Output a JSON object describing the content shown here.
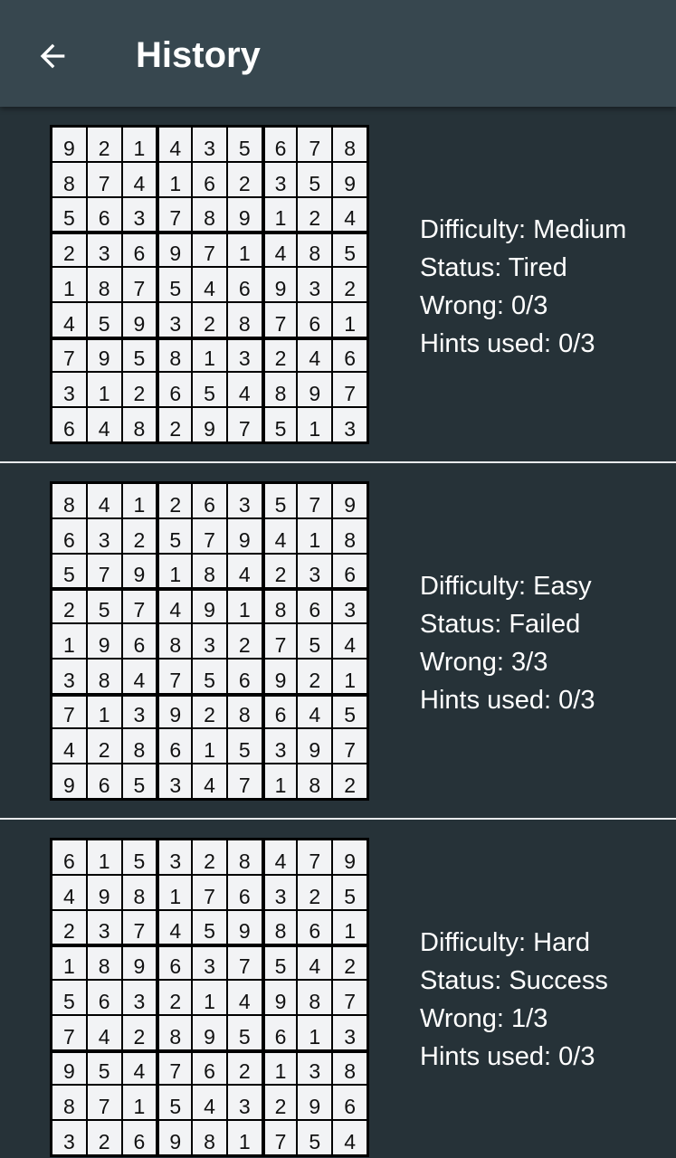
{
  "appbar": {
    "title": "History",
    "back_icon": "arrow-back-icon"
  },
  "colors": {
    "background": "#263238",
    "appbar": "#37474f",
    "cell": "#f2f3f5",
    "text": "#ffffff"
  },
  "history": [
    {
      "difficulty": "Difficulty: Medium",
      "status": "Status: Tired",
      "wrong": "Wrong: 0/3",
      "hints": "Hints used: 0/3",
      "board": [
        [
          9,
          2,
          1,
          4,
          3,
          5,
          6,
          7,
          8
        ],
        [
          8,
          7,
          4,
          1,
          6,
          2,
          3,
          5,
          9
        ],
        [
          5,
          6,
          3,
          7,
          8,
          9,
          1,
          2,
          4
        ],
        [
          2,
          3,
          6,
          9,
          7,
          1,
          4,
          8,
          5
        ],
        [
          1,
          8,
          7,
          5,
          4,
          6,
          9,
          3,
          2
        ],
        [
          4,
          5,
          9,
          3,
          2,
          8,
          7,
          6,
          1
        ],
        [
          7,
          9,
          5,
          8,
          1,
          3,
          2,
          4,
          6
        ],
        [
          3,
          1,
          2,
          6,
          5,
          4,
          8,
          9,
          7
        ],
        [
          6,
          4,
          8,
          2,
          9,
          7,
          5,
          1,
          3
        ]
      ]
    },
    {
      "difficulty": "Difficulty: Easy",
      "status": "Status: Failed",
      "wrong": "Wrong: 3/3",
      "hints": "Hints used: 0/3",
      "board": [
        [
          8,
          4,
          1,
          2,
          6,
          3,
          5,
          7,
          9
        ],
        [
          6,
          3,
          2,
          5,
          7,
          9,
          4,
          1,
          8
        ],
        [
          5,
          7,
          9,
          1,
          8,
          4,
          2,
          3,
          6
        ],
        [
          2,
          5,
          7,
          4,
          9,
          1,
          8,
          6,
          3
        ],
        [
          1,
          9,
          6,
          8,
          3,
          2,
          7,
          5,
          4
        ],
        [
          3,
          8,
          4,
          7,
          5,
          6,
          9,
          2,
          1
        ],
        [
          7,
          1,
          3,
          9,
          2,
          8,
          6,
          4,
          5
        ],
        [
          4,
          2,
          8,
          6,
          1,
          5,
          3,
          9,
          7
        ],
        [
          9,
          6,
          5,
          3,
          4,
          7,
          1,
          8,
          2
        ]
      ]
    },
    {
      "difficulty": "Difficulty: Hard",
      "status": "Status: Success",
      "wrong": "Wrong: 1/3",
      "hints": "Hints used: 0/3",
      "board": [
        [
          6,
          1,
          5,
          3,
          2,
          8,
          4,
          7,
          9
        ],
        [
          4,
          9,
          8,
          1,
          7,
          6,
          3,
          2,
          5
        ],
        [
          2,
          3,
          7,
          4,
          5,
          9,
          8,
          6,
          1
        ],
        [
          1,
          8,
          9,
          6,
          3,
          7,
          5,
          4,
          2
        ],
        [
          5,
          6,
          3,
          2,
          1,
          4,
          9,
          8,
          7
        ],
        [
          7,
          4,
          2,
          8,
          9,
          5,
          6,
          1,
          3
        ],
        [
          9,
          5,
          4,
          7,
          6,
          2,
          1,
          3,
          8
        ],
        [
          8,
          7,
          1,
          5,
          4,
          3,
          2,
          9,
          6
        ],
        [
          3,
          2,
          6,
          9,
          8,
          1,
          7,
          5,
          4
        ]
      ]
    }
  ]
}
